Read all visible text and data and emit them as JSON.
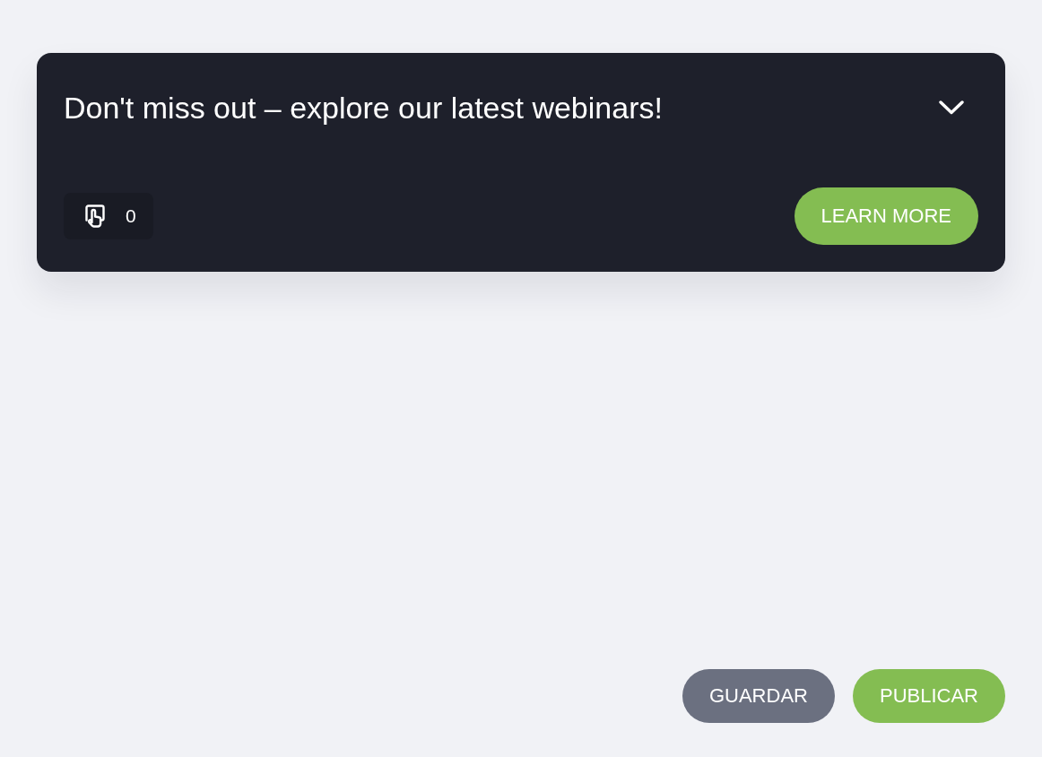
{
  "banner": {
    "title": "Don't miss out – explore our latest webinars!",
    "click_count": "0",
    "cta": "LEARN MORE"
  },
  "actions": [
    {
      "label": "GUARDAR",
      "kind": "secondary"
    },
    {
      "label": "PUBLICAR",
      "kind": "primary"
    }
  ]
}
